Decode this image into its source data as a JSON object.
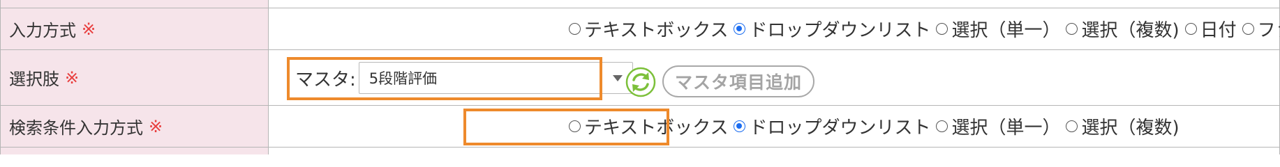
{
  "rows": {
    "input_method": {
      "label": "入力方式",
      "required_mark": "※",
      "options": [
        "テキストボックス",
        "ドロップダウンリスト",
        "選択（単一）",
        "選択（複数)",
        "日付",
        "ファイル"
      ],
      "selected_index": 1
    },
    "choices": {
      "label": "選択肢",
      "required_mark": "※",
      "master_label": "マスタ:",
      "master_select_value": "5段階評価",
      "add_master_button": "マスタ項目追加",
      "refresh_icon": "refresh-icon"
    },
    "search_input_method": {
      "label": "検索条件入力方式",
      "required_mark": "※",
      "options": [
        "テキストボックス",
        "ドロップダウンリスト",
        "選択（単一）",
        "選択（複数)"
      ],
      "selected_index": 1
    }
  },
  "colors": {
    "label_bg": "#f6e4ea",
    "required": "#e83e3e",
    "highlight": "#ee8a2c",
    "radio_checked": "#1a6cf0",
    "refresh_green": "#7cc03a"
  }
}
